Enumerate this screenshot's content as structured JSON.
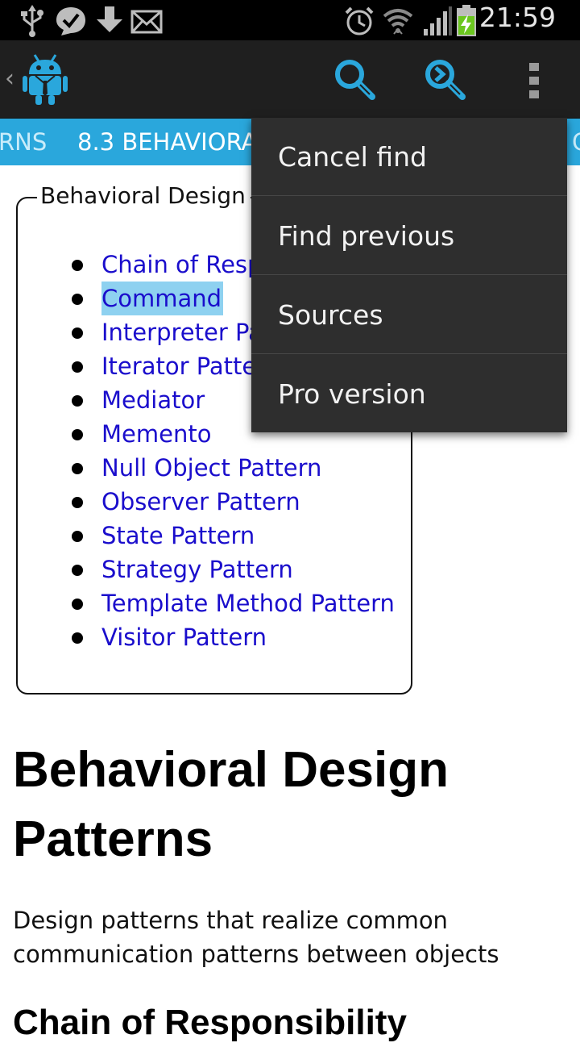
{
  "status_bar": {
    "time": "21:59",
    "icons": [
      "usb-icon",
      "chat-icon",
      "download-icon",
      "email-icon",
      "alarm-icon",
      "wifi-icon",
      "signal-icon",
      "battery-charging-icon"
    ]
  },
  "action_bar": {
    "app_icon": "android-app-icon",
    "actions": [
      "search-icon",
      "find-next-icon",
      "overflow-menu-icon"
    ]
  },
  "tabs": {
    "prev_label": "RNS",
    "current_label": "8.3 BEHAVIORAL DESIGN PATTERNS",
    "next_label": "C"
  },
  "toc": {
    "legend": "Behavioral Design",
    "items": [
      "Chain of Responsibility",
      "Command",
      "Interpreter Pattern",
      "Iterator Pattern",
      "Mediator",
      "Memento",
      "Null Object Pattern",
      "Observer Pattern",
      "State Pattern",
      "Strategy Pattern",
      "Template Method Pattern",
      "Visitor Pattern"
    ],
    "highlighted": "Command"
  },
  "article": {
    "heading": "Behavioral Design Patterns",
    "description": "Design patterns that realize common communication patterns between objects",
    "subheading": "Chain of Responsibility"
  },
  "overflow_menu": {
    "items": [
      "Cancel find",
      "Find previous",
      "Sources",
      "Pro version"
    ]
  },
  "colors": {
    "accent": "#2aa7dc",
    "link": "#1a0dcc",
    "highlight": "#8ed1f0",
    "menu_bg": "#2e2e2e",
    "actionbar_bg": "#1f1f1f"
  }
}
